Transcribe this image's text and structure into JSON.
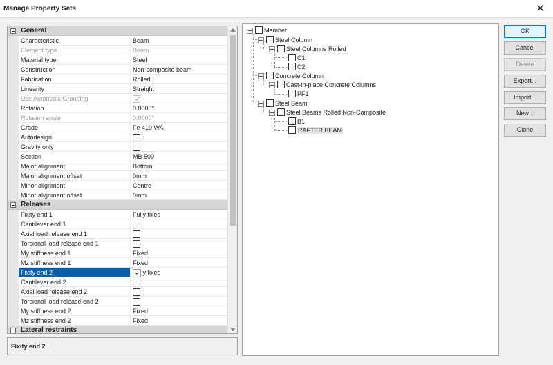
{
  "window": {
    "title": "Manage Property Sets",
    "close_glyph": "✕"
  },
  "property_grid": {
    "categories": {
      "general": "General",
      "releases": "Releases",
      "lateral": "Lateral restraints"
    },
    "general": [
      {
        "name": "Characteristic",
        "value": "Beam"
      },
      {
        "name": "Element type",
        "value": "Beam"
      },
      {
        "name": "Material type",
        "value": "Steel"
      },
      {
        "name": "Construction",
        "value": "Non-composite beam"
      },
      {
        "name": "Fabrication",
        "value": "Rolled"
      },
      {
        "name": "Linearity",
        "value": "Straight"
      },
      {
        "name": "Use Automatic Grouping",
        "value": ""
      },
      {
        "name": "Rotation",
        "value": "0.0000°"
      },
      {
        "name": "Rotation angle",
        "value": "0.0000°"
      },
      {
        "name": "Grade",
        "value": "Fe 410 WA"
      },
      {
        "name": "Autodesign",
        "value": ""
      },
      {
        "name": "Gravity only",
        "value": ""
      },
      {
        "name": "Section",
        "value": "MB 500"
      },
      {
        "name": "Major alignment",
        "value": "Bottom"
      },
      {
        "name": "Major alignment offset",
        "value": "0mm"
      },
      {
        "name": "Minor alignment",
        "value": "Centre"
      },
      {
        "name": "Minor alignment offset",
        "value": "0mm"
      }
    ],
    "releases": [
      {
        "name": "Fixity end 1",
        "value": "Fully fixed"
      },
      {
        "name": "Cantilever end 1",
        "value": ""
      },
      {
        "name": "Axial load release end 1",
        "value": ""
      },
      {
        "name": "Torsional load release end 1",
        "value": ""
      },
      {
        "name": "My stiffness end 1",
        "value": "Fixed"
      },
      {
        "name": "Mz stiffness end 1",
        "value": "Fixed"
      },
      {
        "name": "Fixity end 2",
        "value": "Fully fixed"
      },
      {
        "name": "Cantilever end 2",
        "value": ""
      },
      {
        "name": "Axial load release end 2",
        "value": ""
      },
      {
        "name": "Torsional load release end 2",
        "value": ""
      },
      {
        "name": "My stiffness end 2",
        "value": "Fixed"
      },
      {
        "name": "Mz stiffness end 2",
        "value": "Fixed"
      }
    ]
  },
  "description": {
    "text": "Fixity end 2"
  },
  "tree": {
    "member": "Member",
    "steel_column": "Steel Column",
    "steel_columns_rolled": "Steel Columns Rolled",
    "c1": "C1",
    "c2": "C2",
    "concrete_column": "Concrete Column",
    "cast_in_place": "Cast-in-place Concrete Columns",
    "pf1": "PF1",
    "steel_beam": "Steel Beam",
    "steel_beams_rolled": "Steel Beams Rolled Non-Composite",
    "b1": "B1",
    "rafter_beam": "RAFTER BEAM"
  },
  "buttons": {
    "ok": "OK",
    "cancel": "Cancel",
    "delete": "Delete",
    "export": "Export...",
    "import": "Import...",
    "new": "New...",
    "clone": "Clone"
  },
  "colors": {
    "selection": "#0a5ea6",
    "category_bg": "#d6d6d6",
    "default_button_border": "#0078d7"
  }
}
